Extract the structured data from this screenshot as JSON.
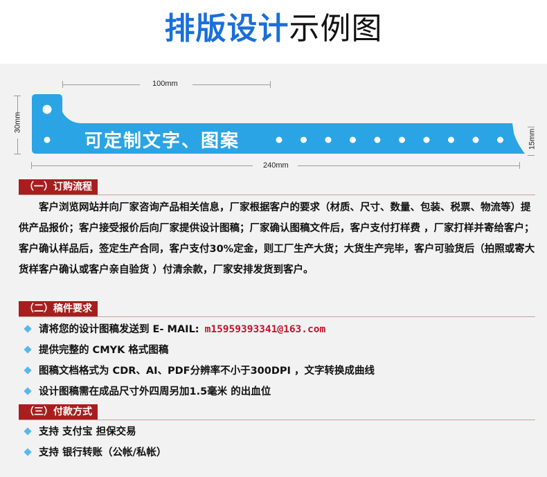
{
  "header": {
    "title_bold": "排版设计",
    "title_rest": "示例图"
  },
  "diagram": {
    "top_dim": "100mm",
    "left_dim": "30mm",
    "right_dim": "15mm",
    "bottom_dim": "240mm",
    "band_text": "可定制文字、图案",
    "band_color": "#2aa4e4",
    "hole_count": 10
  },
  "sections": [
    {
      "heading": "（一）订购流程",
      "paragraph": "客户浏览网站并向厂家咨询产品相关信息，厂家根据客户的要求（材质、尺寸、数量、包装、税票、物流等）提供产品报价；客户接受报价后向厂家提供设计图稿；厂家确认图稿文件后，客户支付打样费 ，厂家打样并寄给客户；客户确认样品后，签定生产合同，客户支付30%定金，则工厂生产大货；大货生产完毕，客户可验货后（拍照或寄大货样客户确认或客户亲自验货 ）付清余款，厂家安排发货到客户。"
    },
    {
      "heading": "（二）稿件要求",
      "bullets": [
        "请将您的设计图稿发送到 E- MAIL:",
        "提供完整的 CMYK 格式图稿",
        "图稿文档格式为 CDR、AI、PDF分辨率不小于300DPI ，文字转换成曲线",
        "设计图稿需在成品尺寸外四周另加1.5毫米 的出血位"
      ],
      "email": "m15959393341@163.com"
    },
    {
      "heading": "（三）付款方式",
      "bullets": [
        "支持 支付宝 担保交易",
        "支持 银行转账（公帐/私帐）"
      ]
    }
  ],
  "colors": {
    "heading_bg": "#a81e1e",
    "title_blue": "#1a6fd9",
    "bullet": "#58b8ee",
    "email": "#c8102e"
  }
}
